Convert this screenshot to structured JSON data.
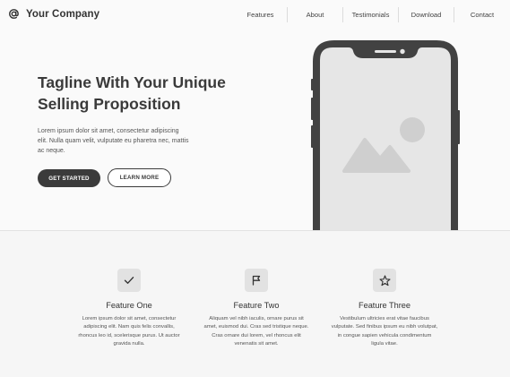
{
  "header": {
    "logo_symbol": "@",
    "company": "Your Company",
    "nav": [
      "Features",
      "About",
      "Testimonials",
      "Download",
      "Contact"
    ]
  },
  "hero": {
    "title_line1": "Tagline With Your Unique",
    "title_line2": "Selling Proposition",
    "text": "Lorem ipsum dolor sit amet, consectetur adipiscing elit. Nulla quam velit, vulputate eu pharetra nec, mattis ac neque.",
    "primary_button": "GET STARTED",
    "secondary_button": "LEARN MORE",
    "image_icon": "image-placeholder-icon"
  },
  "features": [
    {
      "icon": "check-icon",
      "title": "Feature One",
      "text": "Lorem ipsum dolor sit amet, consectetur adipiscing elit. Nam quis felis convallis, rhoncus leo id, scelerisque purus. Ut auctor gravida nulla."
    },
    {
      "icon": "flag-icon",
      "title": "Feature Two",
      "text": "Aliquam vel nibh iaculis, ornare purus sit amet, euismod dui. Cras sed tristique neque. Cras ornare dui lorem, vel rhoncus elit venenatis sit amet."
    },
    {
      "icon": "star-icon",
      "title": "Feature Three",
      "text": "Vestibulum ultricies erat vitae faucibus vulputate. Sed finibus ipsum eu nibh volutpat, in congue sapien vehicula condimentum ligula vitae."
    }
  ],
  "colors": {
    "dark": "#3b3b3b",
    "phone_frame": "#424242",
    "screen": "#e6e6e6",
    "placeholder": "#cfcfcf",
    "background": "#fafafa"
  }
}
